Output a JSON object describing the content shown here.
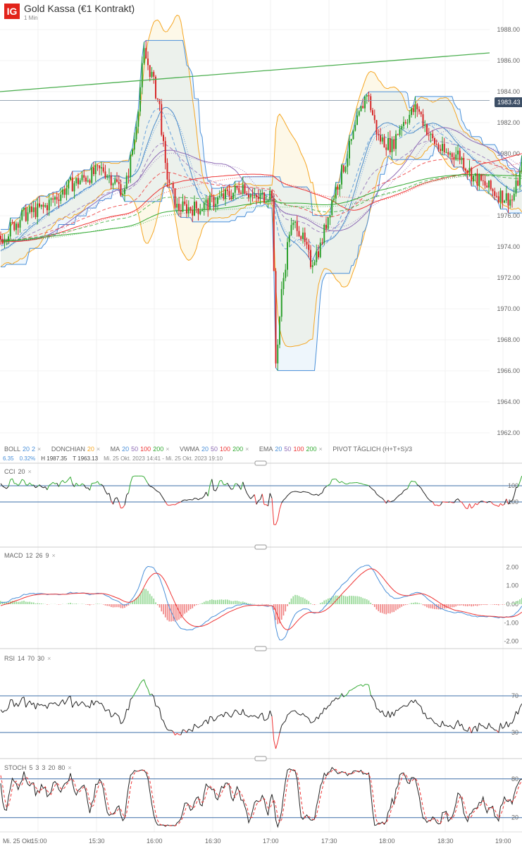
{
  "header": {
    "logo": "IG",
    "title": "Gold Kassa (€1 Kontrakt)",
    "interval": "1 Min"
  },
  "legend": {
    "boll": "BOLL",
    "boll_p": [
      "20",
      "2"
    ],
    "donchian": "DONCHIAN",
    "donchian_p": "20",
    "ma": "MA",
    "ma_p": [
      "20",
      "50",
      "100",
      "200"
    ],
    "vwma": "VWMA",
    "vwma_p": [
      "20",
      "50",
      "100",
      "200"
    ],
    "ema": "EMA",
    "ema_p": [
      "20",
      "50",
      "100",
      "200"
    ],
    "pivot": "PIVOT TÄGLICH (H+T+S)/3",
    "close": "×"
  },
  "info": {
    "change": "6.35",
    "change_pct": "0.32%",
    "high": "H 1987.35",
    "low": "T 1963.13",
    "range": "Mi. 25 Okt. 2023 14:41 - Mi. 25 Okt. 2023 19:10"
  },
  "current_price": "1983.43",
  "panels": {
    "cci": [
      "CCI",
      "20"
    ],
    "macd": [
      "MACD",
      "12",
      "26",
      "9"
    ],
    "rsi": [
      "RSI",
      "14",
      "70",
      "30"
    ],
    "stoch": [
      "STOCH",
      "5",
      "3",
      "3",
      "20",
      "80"
    ]
  },
  "time_axis": [
    "Mi. 25 Okt.",
    "15:00",
    "15:30",
    "16:00",
    "16:30",
    "17:00",
    "17:30",
    "18:00",
    "18:30",
    "19:00"
  ],
  "colors": {
    "up": "#2ca02c",
    "down": "#d62728",
    "blue": "#4a90d9",
    "orange": "#f5a623",
    "purple": "#8e6bb5",
    "red": "#e33",
    "green": "#3a3",
    "accent": "#3d4f66"
  },
  "chart_data": {
    "type": "candlestick",
    "ylim": [
      1961,
      1989
    ],
    "yticks": [
      "1962.00",
      "1964.00",
      "1966.00",
      "1968.00",
      "1970.00",
      "1972.00",
      "1974.00",
      "1976.00",
      "1978.00",
      "1980.00",
      "1982.00",
      "1984.00",
      "1986.00",
      "1988.00"
    ],
    "close_keypoints": [
      [
        0,
        1974.5
      ],
      [
        11,
        1976
      ],
      [
        22,
        1976.5
      ],
      [
        36,
        1978
      ],
      [
        53,
        1979
      ],
      [
        64,
        1977.5
      ],
      [
        69,
        1981
      ],
      [
        74,
        1986.5
      ],
      [
        78,
        1985
      ],
      [
        82,
        1983
      ],
      [
        85,
        1979
      ],
      [
        91,
        1976.5
      ],
      [
        102,
        1976.5
      ],
      [
        120,
        1977.5
      ],
      [
        125,
        1978
      ],
      [
        131,
        1977
      ],
      [
        140,
        1977.5
      ],
      [
        142,
        1966.5
      ],
      [
        145,
        1971
      ],
      [
        149,
        1975
      ],
      [
        153,
        1975.5
      ],
      [
        160,
        1973
      ],
      [
        165,
        1974
      ],
      [
        171,
        1977
      ],
      [
        178,
        1979.5
      ],
      [
        184,
        1982
      ],
      [
        189,
        1984
      ],
      [
        195,
        1981
      ],
      [
        202,
        1980.5
      ],
      [
        207,
        1982
      ],
      [
        215,
        1983
      ],
      [
        222,
        1981
      ],
      [
        229,
        1980
      ],
      [
        236,
        1980
      ],
      [
        244,
        1978.5
      ],
      [
        255,
        1977.5
      ],
      [
        264,
        1977
      ],
      [
        270,
        1979.5
      ]
    ],
    "trendline": [
      1984,
      1986.5
    ],
    "cci_levels": [
      "100",
      "-100"
    ],
    "macd_ticks": [
      "2.00",
      "1.00",
      "0.00",
      "-1.00",
      "-2.00"
    ],
    "rsi_levels": [
      "70",
      "30"
    ],
    "stoch_levels": [
      "80",
      "20"
    ]
  }
}
